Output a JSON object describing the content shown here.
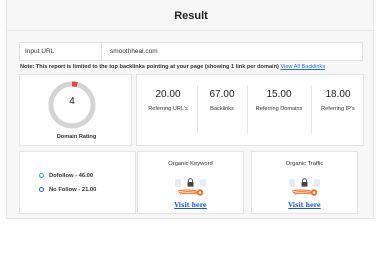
{
  "header": {
    "title": "Result"
  },
  "input": {
    "label": "Input URL",
    "value": "smoothheal.com"
  },
  "note": {
    "text": "Note: This report is limited to the top backlinks pointing at your page (showing 1 link per domain)",
    "link": "View All Backlinks"
  },
  "rating": {
    "value": "4",
    "label": "Domain Rating",
    "fraction": 0.04
  },
  "stats": [
    {
      "value": "20.00",
      "label": "Referring URL's"
    },
    {
      "value": "67.00",
      "label": "Backlinks"
    },
    {
      "value": "15.00",
      "label": "Referring Domains"
    },
    {
      "value": "18.00",
      "label": "Referring IP's"
    }
  ],
  "follow": {
    "dofollow": "Dofollow - 46.00",
    "nofollow": "No Follow - 21.00",
    "dofollow_color": "#1fb39a",
    "nofollow_color": "#1f5fbf"
  },
  "keyword": {
    "title": "Organic Keyword",
    "link": "Visit here"
  },
  "traffic": {
    "title": "Organic Traffic",
    "link": "Visit here"
  },
  "colors": {
    "accent": "#e04a3f",
    "link": "#2b6cd6"
  }
}
